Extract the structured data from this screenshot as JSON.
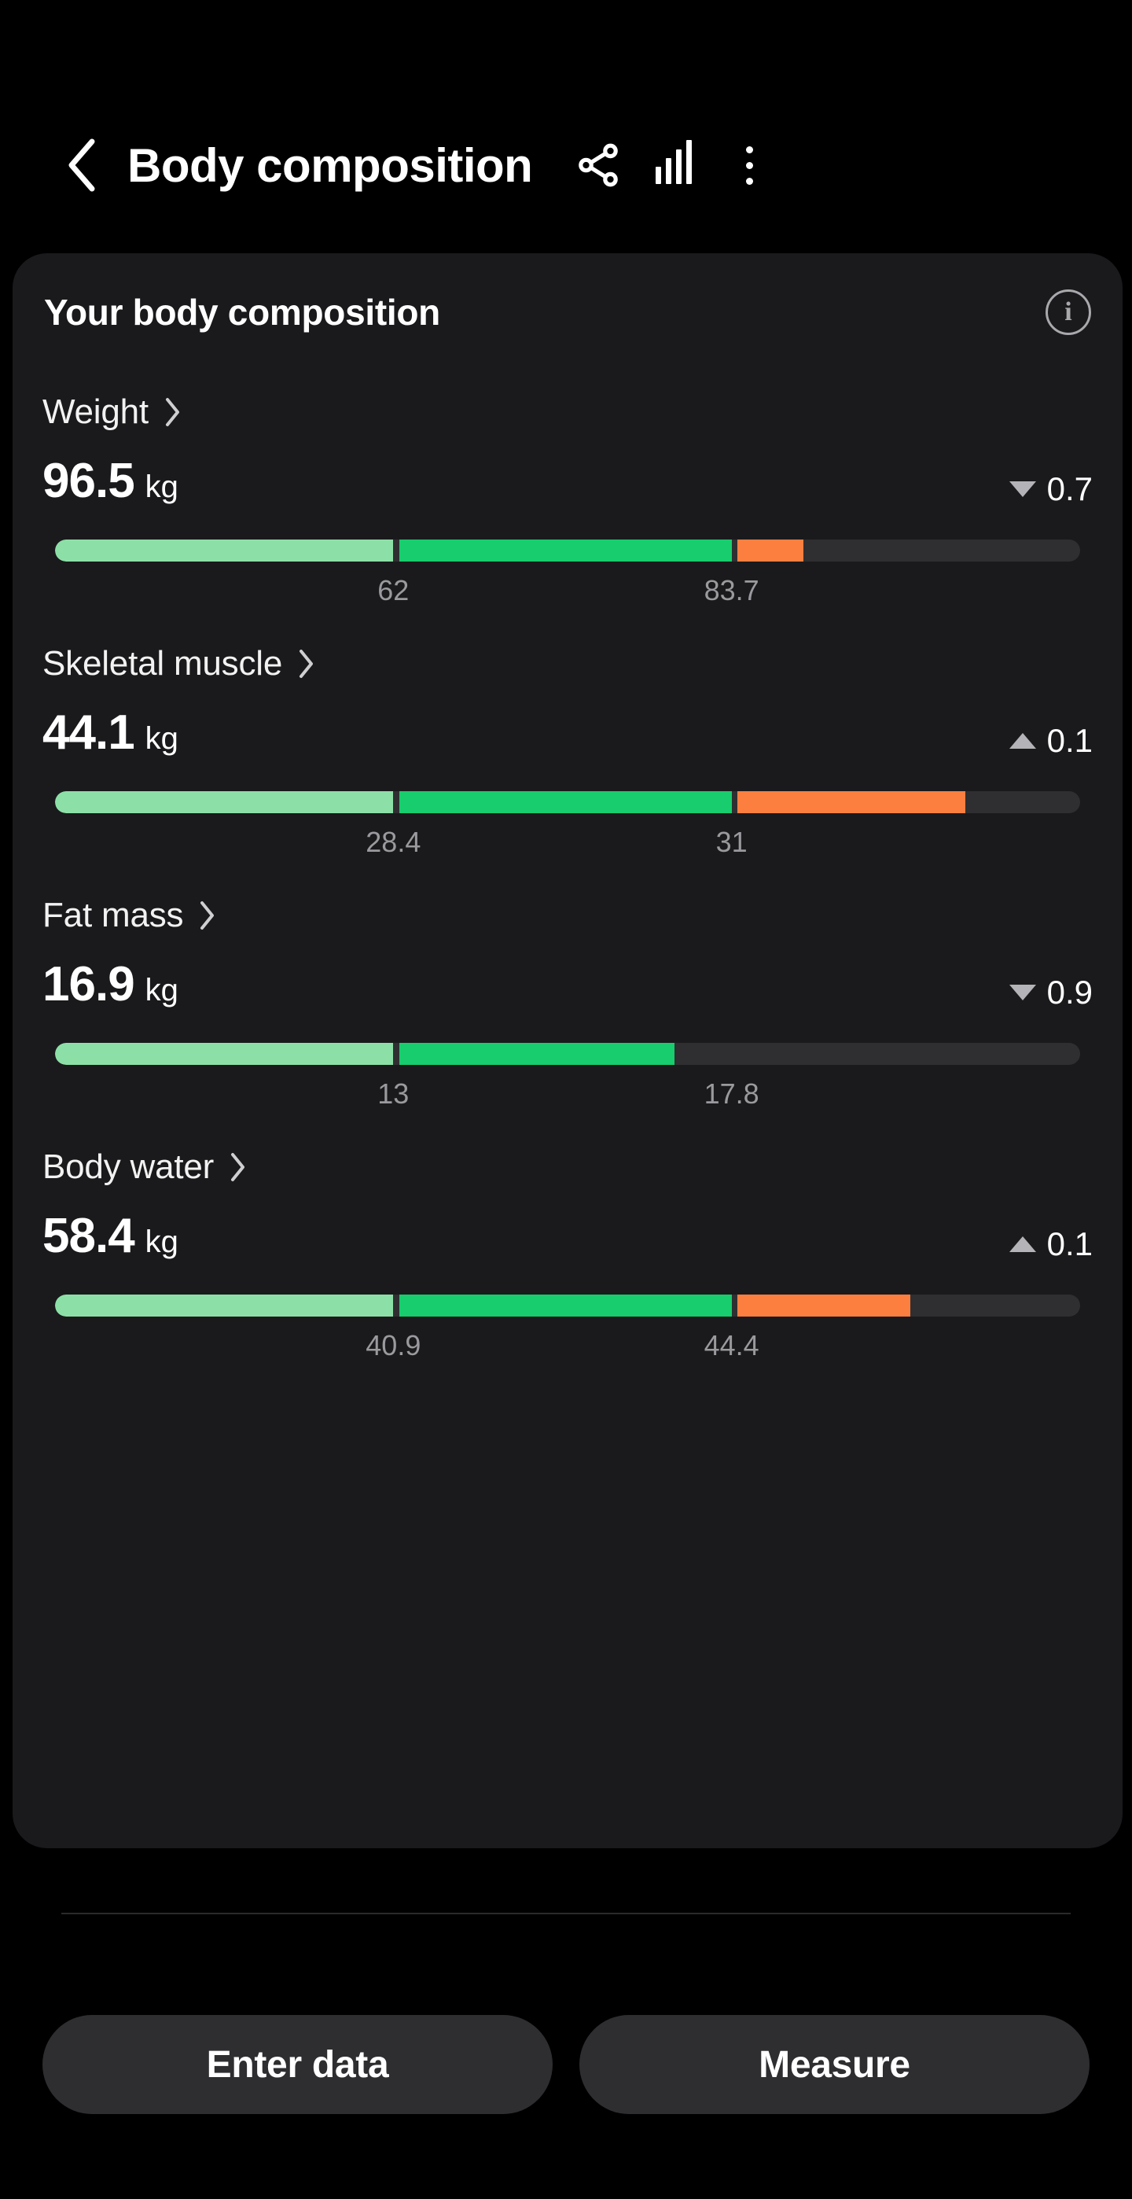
{
  "header": {
    "back_icon": "chevron-left-icon",
    "title": "Body composition",
    "share_icon": "share-icon",
    "chart_icon": "bar-chart-icon",
    "more_icon": "more-vertical-icon"
  },
  "card": {
    "title": "Your body composition",
    "info_icon": "info-icon",
    "info_glyph": "i"
  },
  "metrics": [
    {
      "label": "Weight",
      "value": "96.5",
      "unit": "kg",
      "delta": "0.7",
      "delta_direction": "down",
      "ticks": [
        "62",
        "83.7"
      ],
      "tick_positions": [
        33.0,
        66.0
      ],
      "segments": [
        {
          "name": "below-range",
          "start": 0.0,
          "end": 33.0,
          "color": "#8ce0a7"
        },
        {
          "name": "in-range",
          "start": 33.6,
          "end": 66.0,
          "color": "#17cd6d"
        },
        {
          "name": "above-range",
          "start": 66.6,
          "end": 73.0,
          "color": "#fd7f40"
        }
      ]
    },
    {
      "label": "Skeletal muscle",
      "value": "44.1",
      "unit": "kg",
      "delta": "0.1",
      "delta_direction": "up",
      "ticks": [
        "28.4",
        "31"
      ],
      "tick_positions": [
        33.0,
        66.0
      ],
      "segments": [
        {
          "name": "below-range",
          "start": 0.0,
          "end": 33.0,
          "color": "#8ce0a7"
        },
        {
          "name": "in-range",
          "start": 33.6,
          "end": 66.0,
          "color": "#17cd6d"
        },
        {
          "name": "above-range",
          "start": 66.6,
          "end": 88.8,
          "color": "#fd7f40"
        }
      ]
    },
    {
      "label": "Fat mass",
      "value": "16.9",
      "unit": "kg",
      "delta": "0.9",
      "delta_direction": "down",
      "ticks": [
        "13",
        "17.8"
      ],
      "tick_positions": [
        33.0,
        66.0
      ],
      "segments": [
        {
          "name": "below-range",
          "start": 0.0,
          "end": 33.0,
          "color": "#8ce0a7"
        },
        {
          "name": "in-range",
          "start": 33.6,
          "end": 60.4,
          "color": "#17cd6d"
        }
      ]
    },
    {
      "label": "Body water",
      "value": "58.4",
      "unit": "kg",
      "delta": "0.1",
      "delta_direction": "up",
      "ticks": [
        "40.9",
        "44.4"
      ],
      "tick_positions": [
        33.0,
        66.0
      ],
      "segments": [
        {
          "name": "below-range",
          "start": 0.0,
          "end": 33.0,
          "color": "#8ce0a7"
        },
        {
          "name": "in-range",
          "start": 33.6,
          "end": 66.0,
          "color": "#17cd6d"
        },
        {
          "name": "above-range",
          "start": 66.6,
          "end": 83.4,
          "color": "#fd7f40"
        }
      ]
    }
  ],
  "footer": {
    "enter_data_label": "Enter data",
    "measure_label": "Measure"
  },
  "colors": {
    "background": "#000000",
    "card": "#1a1a1c",
    "track": "#2f2f31",
    "light_green": "#8ce0a7",
    "green": "#17cd6d",
    "orange": "#fd7f40",
    "tick_text": "#9a9a9e",
    "button": "#2e2e31"
  }
}
